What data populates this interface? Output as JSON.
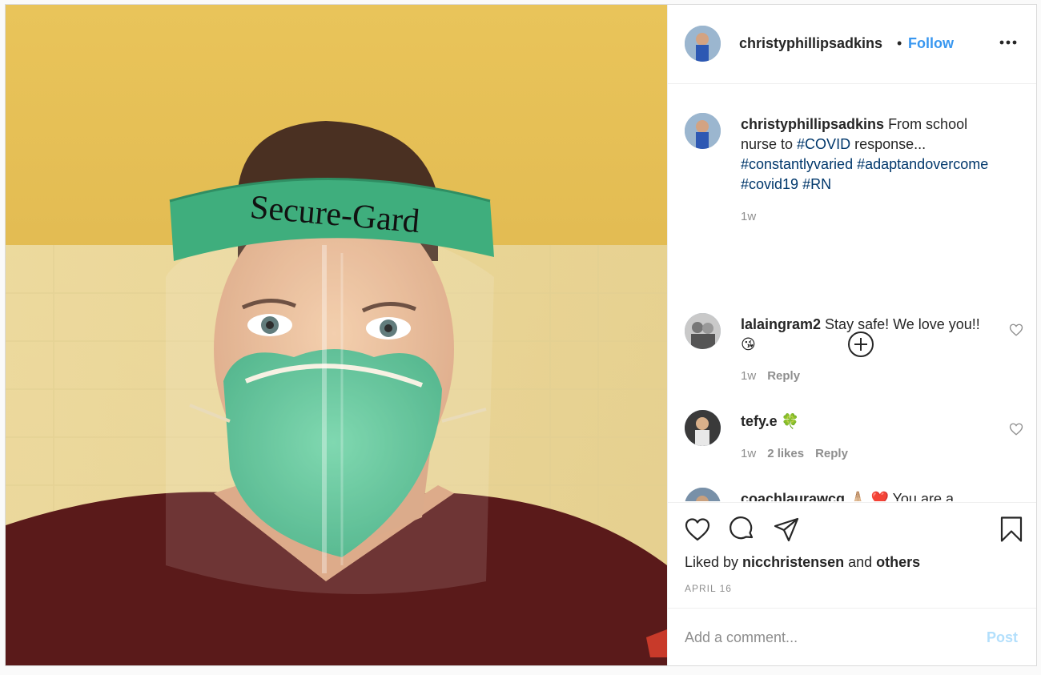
{
  "post": {
    "username": "christyphillipsadkins",
    "separator": "•",
    "follow_label": "Follow",
    "more_icon": "more-horizontal-icon",
    "photo_text": "Secure-Gard"
  },
  "caption": {
    "username": "christyphillipsadkins",
    "text_1": " From school nurse to ",
    "tag_1": "#COVID",
    "text_2": " response... ",
    "tag_2": "#constantlyvaried",
    "tag_3": "#adaptandovercome",
    "tag_4": "#covid19",
    "tag_5": "#RN",
    "time": "1w"
  },
  "load_more_icon": "plus-circle-icon",
  "comments": [
    {
      "username": "lalaingram2",
      "text": " Stay safe! We love you!! 😘",
      "time": "1w",
      "likes": "",
      "reply_label": "Reply"
    },
    {
      "username": "tefy.e",
      "text": " 🍀",
      "time": "1w",
      "likes": "2 likes",
      "reply_label": "Reply"
    },
    {
      "username": "coachlaurawcg",
      "text": " 🙏🏼 ❤️  You are a"
    }
  ],
  "actions": {
    "liked_by_prefix": "Liked by ",
    "liked_by_user": "nicchristensen",
    "liked_by_and": " and ",
    "liked_by_others": "others",
    "date": "APRIL 16"
  },
  "add_comment": {
    "placeholder": "Add a comment...",
    "post_label": "Post"
  },
  "colors": {
    "link_blue": "#3897f0",
    "hashtag": "#00376b",
    "muted": "#8e8e8e",
    "post_disabled": "#b2dffc"
  }
}
